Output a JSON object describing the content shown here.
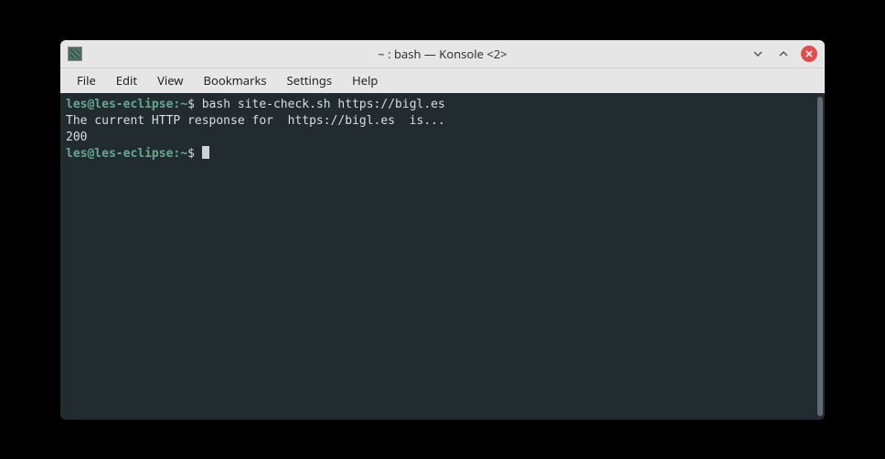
{
  "window": {
    "title": "~ : bash — Konsole <2>"
  },
  "menu": {
    "items": [
      "File",
      "Edit",
      "View",
      "Bookmarks",
      "Settings",
      "Help"
    ]
  },
  "terminal": {
    "prompt": {
      "user": "les",
      "host": "les-eclipse",
      "path": "~",
      "symbol": "$"
    },
    "lines": [
      {
        "type": "cmd",
        "text": "bash site-check.sh https://bigl.es"
      },
      {
        "type": "out",
        "text": "The current HTTP response for  https://bigl.es  is..."
      },
      {
        "type": "out",
        "text": "200"
      },
      {
        "type": "prompt_only"
      }
    ]
  }
}
